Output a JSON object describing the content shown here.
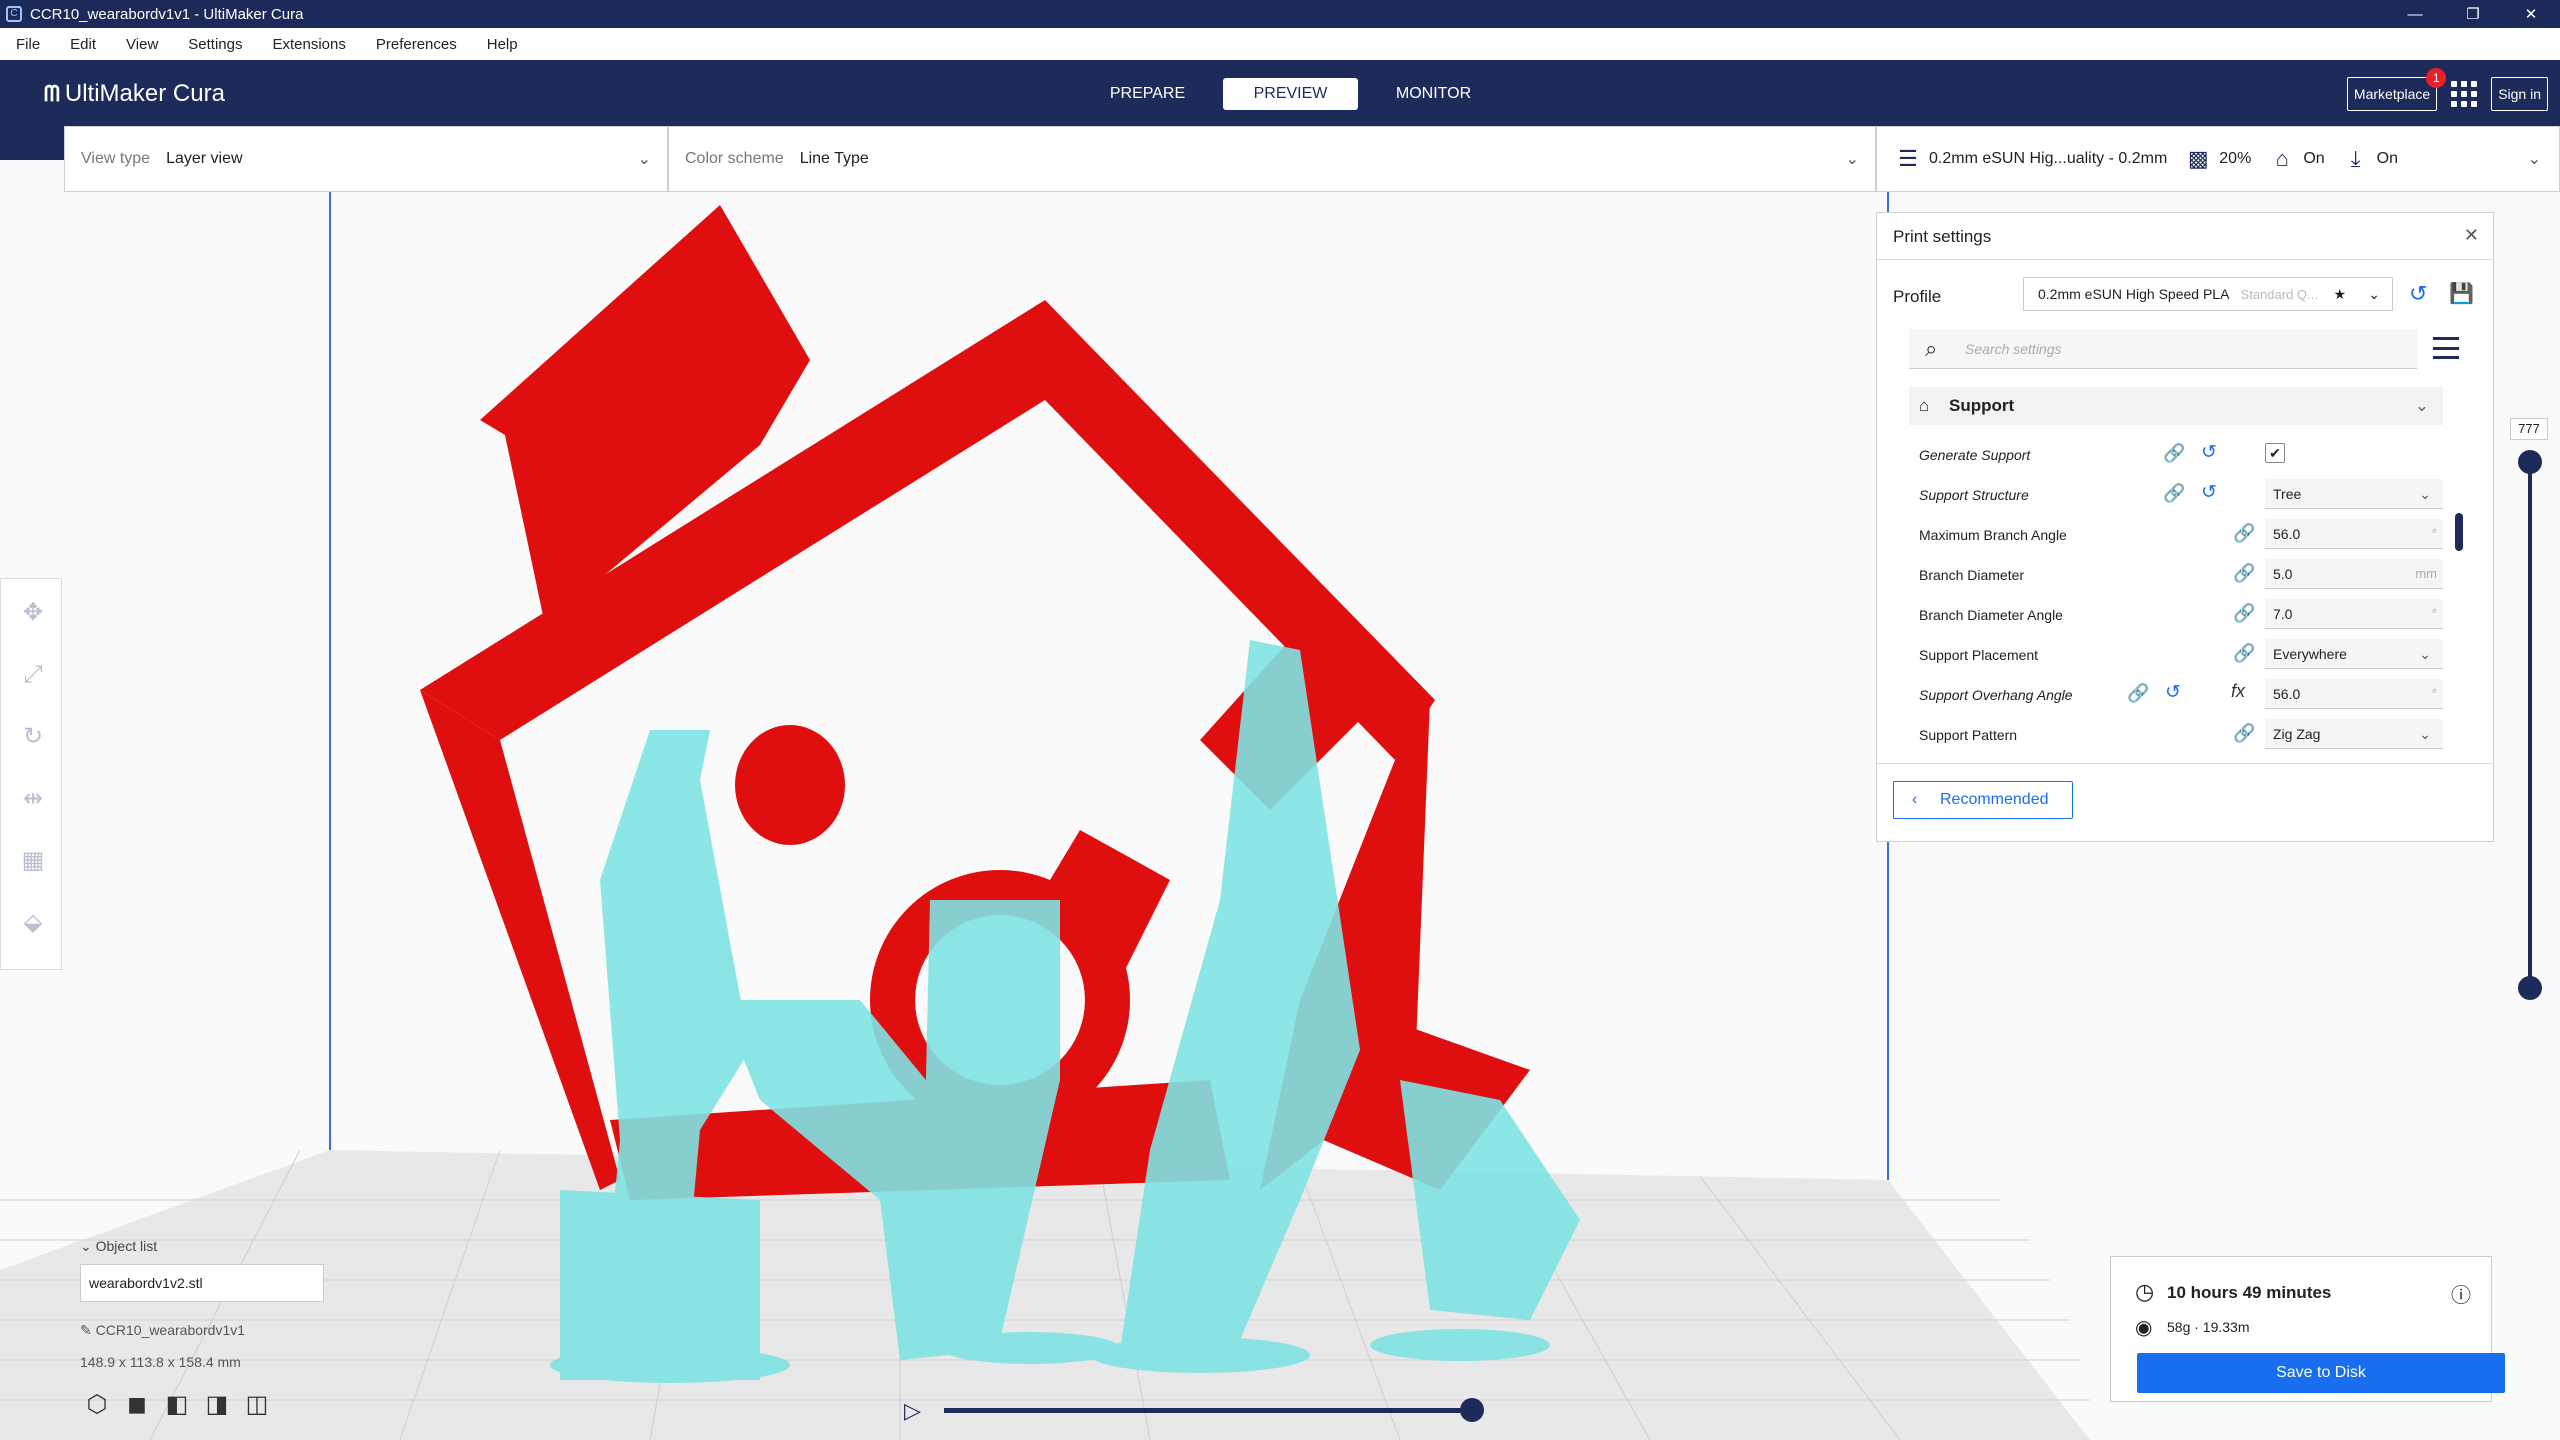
{
  "window": {
    "title": "CCR10_wearabordv1v1 - UltiMaker Cura",
    "minimize": "—",
    "restore": "❐",
    "close": "✕"
  },
  "menu": [
    "File",
    "Edit",
    "View",
    "Settings",
    "Extensions",
    "Preferences",
    "Help"
  ],
  "header": {
    "logo": "UltiMaker Cura",
    "tabs": [
      "PREPARE",
      "PREVIEW",
      "MONITOR"
    ],
    "active_tab": "PREVIEW",
    "marketplace": "Marketplace",
    "marketplace_badge": "1",
    "signin": "Sign in"
  },
  "viewbar": {
    "view_type_label": "View type",
    "view_type_value": "Layer view",
    "color_scheme_label": "Color scheme",
    "color_scheme_value": "Line Type"
  },
  "printbar": {
    "profile": "0.2mm eSUN Hig...uality - 0.2mm",
    "infill": "20%",
    "support": "On",
    "adhesion": "On"
  },
  "print_settings": {
    "title": "Print settings",
    "profile_label": "Profile",
    "profile_name": "0.2mm eSUN High Speed PLA",
    "profile_sub": "Standard Q...",
    "search_placeholder": "Search settings",
    "category": "Support",
    "rows": [
      {
        "label": "Generate Support",
        "value": "✔"
      },
      {
        "label": "Support Structure",
        "value": "Tree"
      },
      {
        "label": "Maximum Branch Angle",
        "value": "56.0",
        "unit": "°"
      },
      {
        "label": "Branch Diameter",
        "value": "5.0",
        "unit": "mm"
      },
      {
        "label": "Branch Diameter Angle",
        "value": "7.0",
        "unit": "°"
      },
      {
        "label": "Support Placement",
        "value": "Everywhere"
      },
      {
        "label": "Support Overhang Angle",
        "value": "56.0",
        "unit": "°"
      },
      {
        "label": "Support Pattern",
        "value": "Zig Zag"
      }
    ],
    "recommended": "Recommended"
  },
  "layer_slider": {
    "value": "777",
    "fraction": 1.0
  },
  "object_list": {
    "header": "Object list",
    "file": "wearabordv1v2.stl",
    "name": "CCR10_wearabordv1v1",
    "dimensions": "148.9 x 113.8 x 158.4 mm"
  },
  "path_slider": {
    "fraction": 1.0
  },
  "estimate": {
    "time": "10 hours 49 minutes",
    "material": "58g · 19.33m",
    "save": "Save to Disk"
  },
  "colors": {
    "header": "#1c2b5a",
    "accent": "#196ef0",
    "model_wall": "#e00f0f",
    "support": "#7fe3e3",
    "build_plate": "#e6e6e6"
  }
}
